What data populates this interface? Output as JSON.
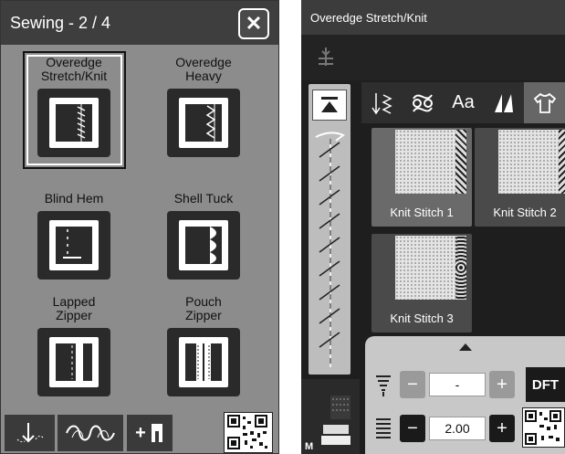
{
  "left_screen": {
    "title": "Sewing - 2 / 4",
    "close_label": "✕",
    "stitches": [
      {
        "label": "Overedge\nStretch/Knit",
        "selected": true,
        "icon": "overedge-stretch-icon"
      },
      {
        "label": "Overedge\nHeavy",
        "selected": false,
        "icon": "overedge-heavy-icon"
      },
      {
        "label": "Blind Hem",
        "selected": false,
        "icon": "blind-hem-icon"
      },
      {
        "label": "Shell Tuck",
        "selected": false,
        "icon": "shell-tuck-icon"
      },
      {
        "label": "Lapped\nZipper",
        "selected": false,
        "icon": "lapped-zipper-icon"
      },
      {
        "label": "Pouch\nZipper",
        "selected": false,
        "icon": "pouch-zipper-icon"
      }
    ],
    "toolbar": [
      {
        "icon": "stitch-sequence-icon"
      },
      {
        "icon": "decorative-stitch-icon"
      },
      {
        "label": "+",
        "icon": "presser-foot-icon"
      }
    ],
    "qr_icon": "qr-code-icon"
  },
  "right_screen": {
    "title": "Overedge Stretch/Knit",
    "tabs": [
      {
        "label": "",
        "icon": "utility-stitch-icon"
      },
      {
        "label": "",
        "icon": "decorative-loop-icon"
      },
      {
        "label": "Aa",
        "icon": "font-icon"
      },
      {
        "label": "",
        "icon": "quilt-icon"
      },
      {
        "label": "",
        "icon": "shirt-icon",
        "active": true
      }
    ],
    "knit_stitches": [
      {
        "name": "Knit Stitch 1"
      },
      {
        "name": "Knit Stitch 2"
      },
      {
        "name": "Knit Stitch 3"
      }
    ],
    "sequence_label": "M",
    "controls": [
      {
        "name": "stitch-width",
        "value": "-",
        "enabled": false
      },
      {
        "name": "stitch-length",
        "value": "2.00",
        "enabled": true
      }
    ],
    "dft_label": "DFT",
    "colors": {
      "accent_dark": "#1e1e1e",
      "panel_gray": "#c8c8c8",
      "disabled": "#9a9a9a"
    }
  }
}
